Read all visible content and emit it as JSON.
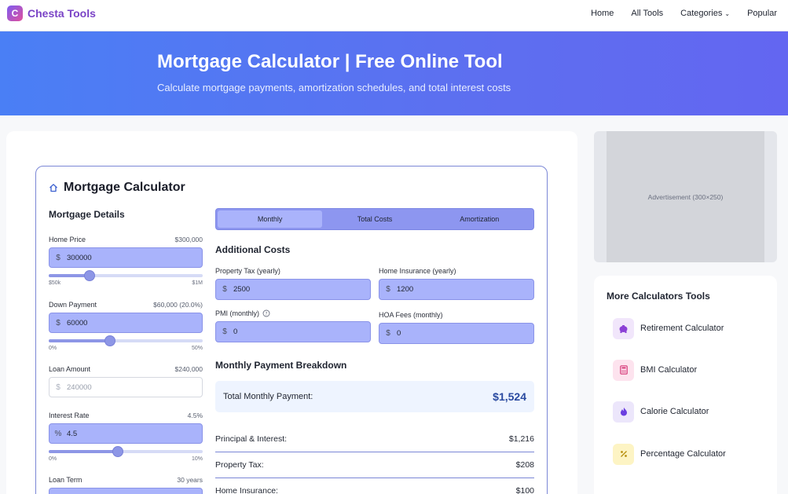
{
  "brand": {
    "badge": "C",
    "name": "Chesta Tools"
  },
  "nav": {
    "home": "Home",
    "all_tools": "All Tools",
    "categories": "Categories",
    "popular": "Popular"
  },
  "hero": {
    "title": "Mortgage Calculator | Free Online Tool",
    "subtitle": "Calculate mortgage payments, amortization schedules, and total interest costs"
  },
  "calc": {
    "title": "Mortgage Calculator",
    "details_heading": "Mortgage Details",
    "home_price": {
      "label": "Home Price",
      "display": "$300,000",
      "prefix": "$",
      "value": "300000",
      "min_label": "$50k",
      "max_label": "$1M",
      "fraction": 0.263
    },
    "down_payment": {
      "label": "Down Payment",
      "display": "$60,000 (20.0%)",
      "prefix": "$",
      "value": "60000",
      "min_label": "0%",
      "max_label": "50%",
      "fraction": 0.4
    },
    "loan_amount": {
      "label": "Loan Amount",
      "display": "$240,000",
      "prefix": "$",
      "value": "240000"
    },
    "interest_rate": {
      "label": "Interest Rate",
      "display": "4.5%",
      "prefix": "%",
      "value": "4.5",
      "min_label": "0%",
      "max_label": "10%",
      "fraction": 0.45
    },
    "loan_term": {
      "label": "Loan Term",
      "display": "30 years"
    },
    "tabs": {
      "monthly": "Monthly",
      "total_costs": "Total Costs",
      "amortization": "Amortization"
    },
    "additional_heading": "Additional Costs",
    "property_tax": {
      "label": "Property Tax (yearly)",
      "prefix": "$",
      "value": "2500"
    },
    "home_insurance": {
      "label": "Home Insurance (yearly)",
      "prefix": "$",
      "value": "1200"
    },
    "pmi": {
      "label": "PMI (monthly)",
      "prefix": "$",
      "value": "0"
    },
    "hoa": {
      "label": "HOA Fees (monthly)",
      "prefix": "$",
      "value": "0"
    },
    "breakdown_heading": "Monthly Payment Breakdown",
    "total": {
      "label": "Total Monthly Payment:",
      "value": "$1,524"
    },
    "rows": [
      {
        "label": "Principal & Interest:",
        "value": "$1,216"
      },
      {
        "label": "Property Tax:",
        "value": "$208"
      },
      {
        "label": "Home Insurance:",
        "value": "$100"
      }
    ]
  },
  "sidebar": {
    "ad_text": "Advertisement (300×250)",
    "more_heading": "More Calculators Tools",
    "tools": [
      {
        "label": "Retirement Calculator",
        "icon": "piggy-bank-icon",
        "bg": "#f1e6fb",
        "color": "#8b3fd6"
      },
      {
        "label": "BMI Calculator",
        "icon": "calculator-icon",
        "bg": "#fde3ee",
        "color": "#d63b7a"
      },
      {
        "label": "Calorie Calculator",
        "icon": "flame-icon",
        "bg": "#ece6fb",
        "color": "#6a3ee0"
      },
      {
        "label": "Percentage Calculator",
        "icon": "percent-icon",
        "bg": "#fdf4c4",
        "color": "#b89010"
      }
    ]
  },
  "colors": {
    "accent": "#6366f1",
    "input_bg": "#a9b3fb",
    "total_value": "#2a4aa0"
  }
}
